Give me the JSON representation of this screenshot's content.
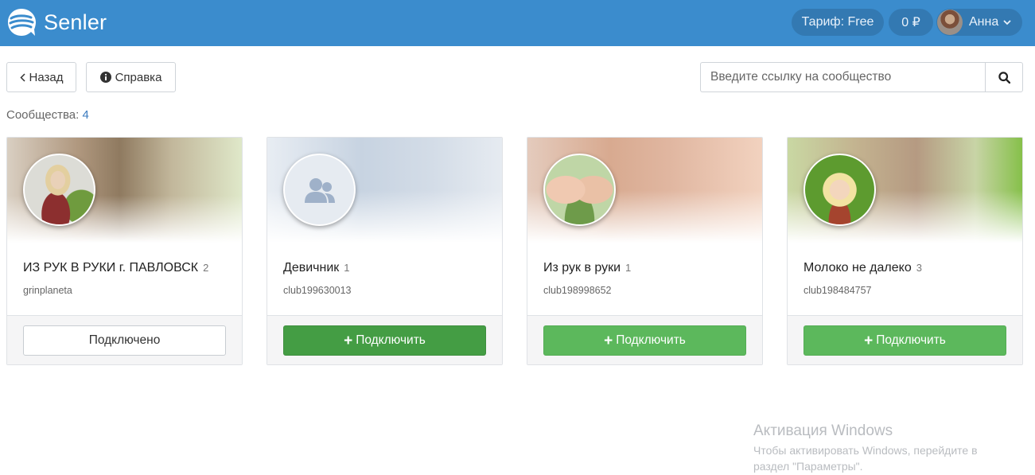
{
  "header": {
    "brand": "Senler",
    "tariff": "Тариф: Free",
    "balance": "0 ₽",
    "user_name": "Анна"
  },
  "toolbar": {
    "back_label": "Назад",
    "help_label": "Справка",
    "search_placeholder": "Введите ссылку на сообщество"
  },
  "communities": {
    "count_label": "Сообщества:",
    "count": "4",
    "items": [
      {
        "name": "ИЗ РУК В РУКИ г. ПАВЛОВСК",
        "members": "2",
        "slug": "grinplaneta",
        "action": "Подключено",
        "state": "connected"
      },
      {
        "name": "Девичник",
        "members": "1",
        "slug": "club199630013",
        "action": "Подключить",
        "state": "connect-hover"
      },
      {
        "name": "Из рук в руки",
        "members": "1",
        "slug": "club198998652",
        "action": "Подключить",
        "state": "connect"
      },
      {
        "name": "Молоко не далеко",
        "members": "3",
        "slug": "club198484757",
        "action": "Подключить",
        "state": "connect"
      }
    ]
  },
  "watermark": {
    "title": "Активация Windows",
    "text": "Чтобы активировать Windows, перейдите в раздел \"Параметры\"."
  },
  "icons": {
    "logo": "senler-logo-icon",
    "caret": "chevron-down-icon",
    "back": "chevron-left-icon",
    "help": "info-circle-icon",
    "search": "search-icon",
    "group": "group-placeholder-icon",
    "plus": "plus-icon"
  },
  "colors": {
    "header": "#3b8ccd",
    "success": "#5cb85c",
    "success_active": "#449d44"
  }
}
